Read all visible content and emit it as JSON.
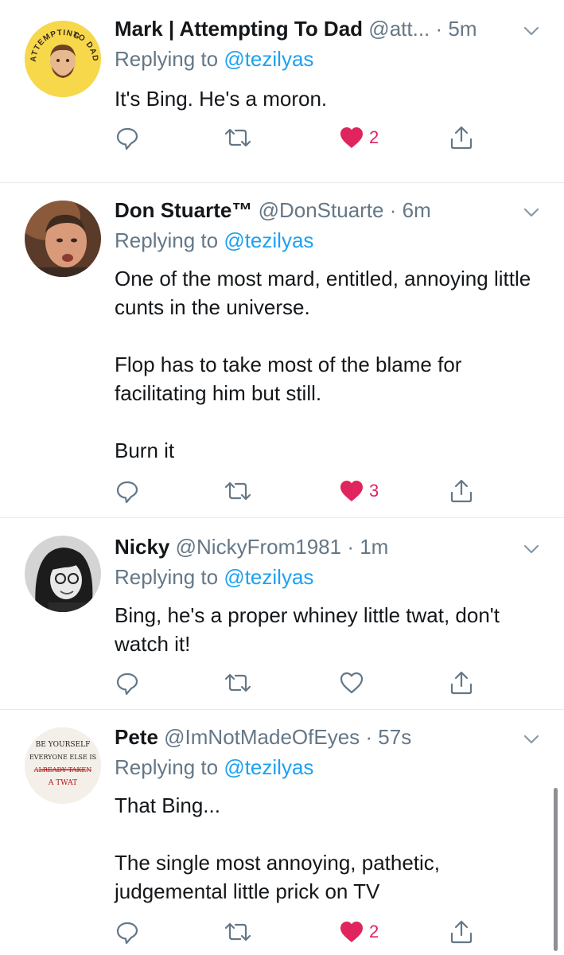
{
  "colors": {
    "link": "#1da1f2",
    "muted": "#657786",
    "like": "#e0245e",
    "divider": "#e6ecf0"
  },
  "tweets": [
    {
      "name": "Mark | Attempting To Dad",
      "handle": "@att...",
      "time": "· 5m",
      "replying_prefix": "Replying to",
      "replying_to": "@tezilyas",
      "avatar_text_top": "ATTEMPTING",
      "avatar_text_bottom": "TO DAD",
      "paragraphs": [
        "It's Bing. He's a moron."
      ],
      "likes": "2",
      "liked": true,
      "icons": [
        "reply-icon",
        "retweet-icon",
        "heart-icon",
        "share-icon"
      ]
    },
    {
      "name": "Don Stuarte™",
      "handle": "@DonStuarte",
      "time": "· 6m",
      "replying_prefix": "Replying to",
      "replying_to": "@tezilyas",
      "paragraphs": [
        "One of the most mard, entitled, annoying little cunts in the universe.",
        "Flop has to take most of the blame for facilitating him but still.",
        "Burn it"
      ],
      "likes": "3",
      "liked": true
    },
    {
      "name": "Nicky",
      "handle": "@NickyFrom1981",
      "time": "· 1m",
      "replying_prefix": "Replying to",
      "replying_to": "@tezilyas",
      "paragraphs": [
        "Bing, he's a proper whiney little twat, don't watch it!"
      ],
      "likes": "",
      "liked": false
    },
    {
      "name": "Pete",
      "handle": "@ImNotMadeOfEyes",
      "time": "· 57s",
      "replying_prefix": "Replying to",
      "replying_to": "@tezilyas",
      "avatar_lines": [
        "BE YOURSELF",
        "EVERYONE ELSE IS",
        "ALREADY TAKEN",
        "A TWAT"
      ],
      "paragraphs": [
        "That Bing...",
        "The single most annoying, pathetic, judgemental little prick on TV"
      ],
      "likes": "2",
      "liked": true
    }
  ]
}
